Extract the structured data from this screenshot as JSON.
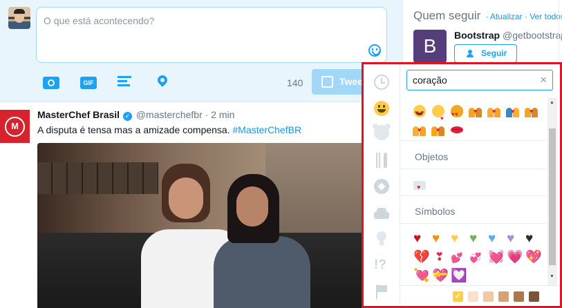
{
  "composer": {
    "placeholder": "O que está acontecendo?",
    "char_count": "140",
    "tweet_label": "Tweet",
    "tools": [
      "camera-icon",
      "gif-icon",
      "poll-icon",
      "location-icon"
    ]
  },
  "tweet": {
    "name": "MasterChef Brasil",
    "handle": "@masterchefbr",
    "dot": "·",
    "time": "2 min",
    "text": "A disputa é tensa mas a amizade compensa. ",
    "hashtag": "#MasterChefBR"
  },
  "sidebar": {
    "title": "Quem seguir",
    "sep": "·",
    "refresh": "Atualizar",
    "view_all": "Ver todos",
    "suggestion": {
      "avatar_letter": "B",
      "name": "Bootstrap",
      "handle": "@getbootstrap",
      "follow_label": "Seguir"
    }
  },
  "emoji_picker": {
    "search_value": "coração",
    "clear": "×",
    "categories": [
      "recent-icon",
      "smileys-icon",
      "animals-icon",
      "food-icon",
      "activity-icon",
      "travel-icon",
      "objects-icon",
      "symbols-icon",
      "flags-icon"
    ],
    "symbols_glyph": "!?",
    "sections": {
      "objects": "Objetos",
      "symbols": "Símbolos"
    },
    "heart_colors": [
      "#c9171e",
      "#f4900c",
      "#ffcc4d",
      "#77b255",
      "#5dadec",
      "#aa8ed6",
      "#292f33"
    ],
    "skin_tones": [
      "#ffcc4d",
      "#fce0cd",
      "#efcaa4",
      "#d3a277",
      "#a9784e",
      "#7d5339"
    ],
    "accent_color": "#1da1f2",
    "highlight_border": "#e0141e"
  }
}
